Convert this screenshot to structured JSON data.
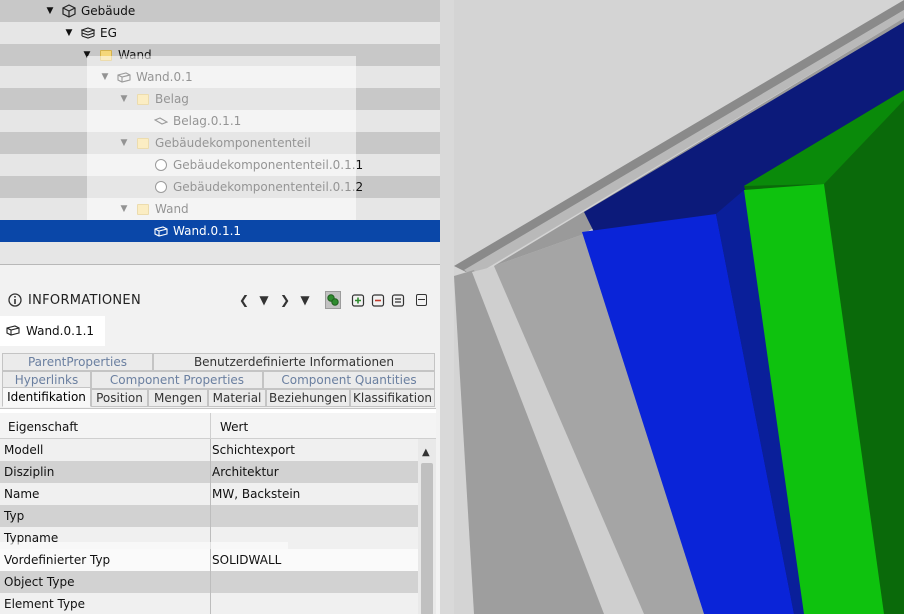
{
  "tree": {
    "items": [
      {
        "label": "Gebäude",
        "icon": "building-icon"
      },
      {
        "label": "EG",
        "icon": "storey-icon"
      },
      {
        "label": "Wand",
        "icon": "folder-icon"
      },
      {
        "label": "Wand.0.1",
        "icon": "wall-icon"
      },
      {
        "label": "Belag",
        "icon": "folder-icon"
      },
      {
        "label": "Belag.0.1.1",
        "icon": "covering-icon"
      },
      {
        "label": "Gebäudekomponententeil",
        "icon": "folder-icon"
      },
      {
        "label": "Gebäudekomponententeil.0.1.1",
        "icon": "circle-icon"
      },
      {
        "label": "Gebäudekomponententeil.0.1.2",
        "icon": "circle-icon"
      },
      {
        "label": "Wand",
        "icon": "folder-icon"
      },
      {
        "label": "Wand.0.1.1",
        "icon": "wall-icon",
        "selected": true
      }
    ]
  },
  "info": {
    "title": "INFORMATIONEN",
    "element_name": "Wand.0.1.1",
    "tabs_row1": [
      "ParentProperties",
      "Benutzerdefinierte Informationen"
    ],
    "tabs_row2": [
      "Hyperlinks",
      "Component Properties",
      "Component Quantities"
    ],
    "tabs_row3": [
      "Identifikation",
      "Position",
      "Mengen",
      "Material",
      "Beziehungen",
      "Klassifikation"
    ],
    "active_tab": "Identifikation",
    "columns": {
      "property": "Eigenschaft",
      "value": "Wert"
    },
    "rows": [
      {
        "k": "Modell",
        "v": "Schichtexport"
      },
      {
        "k": "Disziplin",
        "v": "Architektur"
      },
      {
        "k": "Name",
        "v": "MW, Backstein"
      },
      {
        "k": "Typ",
        "v": ""
      },
      {
        "k": "Typname",
        "v": ""
      },
      {
        "k": "Vordefinierter Typ",
        "v": "SOLIDWALL"
      },
      {
        "k": "Object Type",
        "v": ""
      },
      {
        "k": "Element Type",
        "v": ""
      }
    ]
  },
  "colors": {
    "selection": "#0a47a8",
    "layer_blue": "#0a24d8",
    "layer_dark_blue": "#0c1a7a",
    "layer_green": "#0ec20e",
    "layer_dark_green": "#0a6a0a",
    "layer_grey": "#a3a3a3"
  }
}
